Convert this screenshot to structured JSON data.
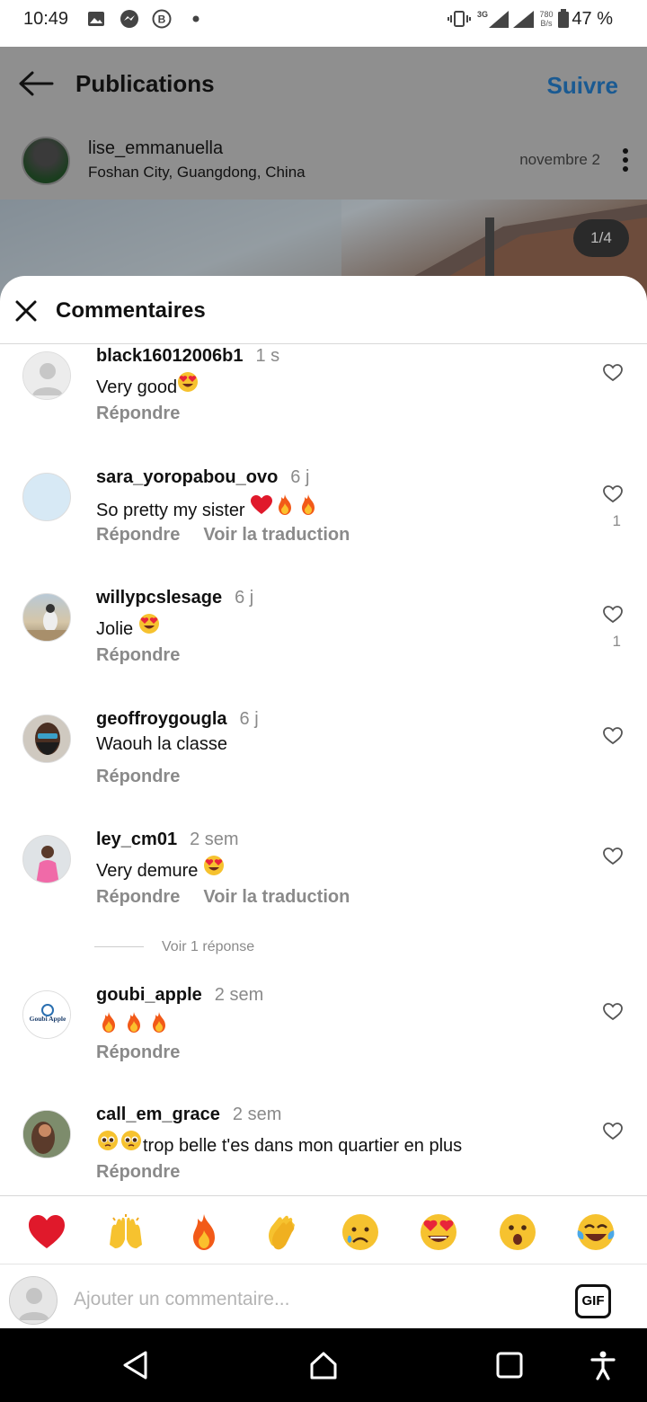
{
  "status_bar": {
    "time": "10:49",
    "network": "3G",
    "speed": "780 B/s",
    "battery": "47 %"
  },
  "post_header": {
    "title": "Publications",
    "follow_label": "Suivre",
    "username": "lise_emmanuella",
    "location": "Foshan City, Guangdong, China",
    "date": "novembre 2",
    "image_counter": "1/4"
  },
  "comments_sheet": {
    "title": "Commentaires",
    "reply_label": "Répondre",
    "translate_label": "Voir la traduction",
    "view_replies": "Voir 1 réponse",
    "comments": [
      {
        "user": "black16012006b1",
        "time": "1 s",
        "text": "Very good",
        "emoji": [
          "heart-eyes"
        ],
        "likes": "",
        "translate": false
      },
      {
        "user": "sara_yoropabou_ovo",
        "time": "6 j",
        "text": "So pretty my sister ",
        "emoji": [
          "red-heart",
          "fire",
          "fire"
        ],
        "likes": "1",
        "translate": true
      },
      {
        "user": "willypcslesage",
        "time": "6 j",
        "text": "Jolie ",
        "emoji": [
          "heart-eyes"
        ],
        "likes": "1",
        "translate": false
      },
      {
        "user": "geoffroygougla",
        "time": "6 j",
        "text": "Waouh la classe",
        "emoji": [],
        "likes": "",
        "translate": false
      },
      {
        "user": "ley_cm01",
        "time": "2 sem",
        "text": "Very demure ",
        "emoji": [
          "heart-eyes"
        ],
        "likes": "",
        "translate": true
      },
      {
        "user": "goubi_apple",
        "time": "2 sem",
        "text": "",
        "emoji": [
          "fire",
          "fire",
          "fire"
        ],
        "likes": "",
        "translate": false
      },
      {
        "user": "call_em_grace",
        "time": "2 sem",
        "text": "trop belle t'es dans mon quartier en plus",
        "emoji": [
          "pleading",
          "pleading"
        ],
        "likes": "",
        "translate": false
      }
    ]
  },
  "reactions": [
    "red-heart",
    "raised-hands",
    "fire",
    "clapping-hands",
    "sad-face",
    "heart-eyes",
    "surprised-face",
    "tears-of-joy"
  ],
  "composer": {
    "placeholder": "Ajouter un commentaire...",
    "gif_label": "GIF"
  },
  "goubi_avatar_text": "Goubi Apple"
}
